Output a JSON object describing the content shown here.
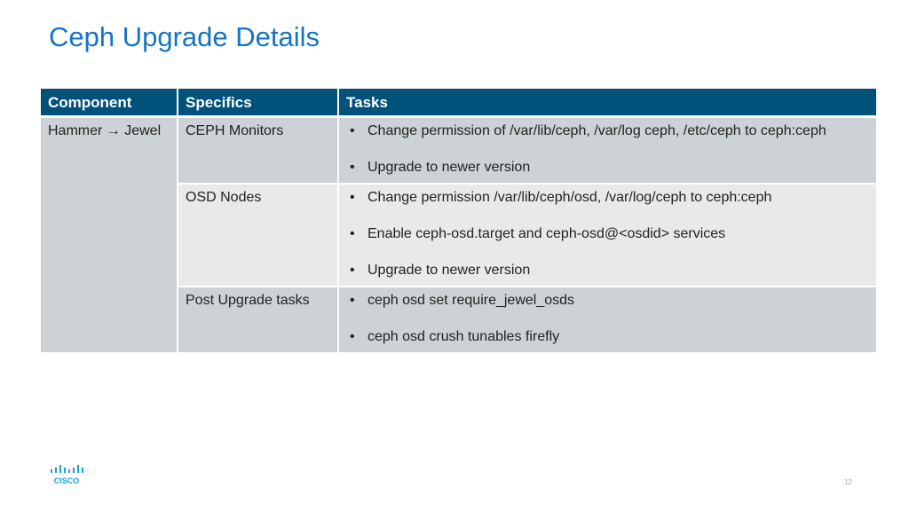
{
  "title": "Ceph Upgrade Details",
  "table": {
    "headers": [
      "Component",
      "Specifics",
      "Tasks"
    ],
    "component": "Hammer → Jewel",
    "rows": [
      {
        "specifics": "CEPH Monitors",
        "tasks": [
          "Change permission of /var/lib/ceph, /var/log ceph, /etc/ceph to ceph:ceph",
          "Upgrade to newer version"
        ]
      },
      {
        "specifics": "OSD Nodes",
        "tasks": [
          "Change permission /var/lib/ceph/osd, /var/log/ceph to ceph:ceph",
          "Enable ceph-osd.target and ceph-osd@<osdid> services",
          "Upgrade to newer version"
        ]
      },
      {
        "specifics": "Post Upgrade tasks",
        "tasks": [
          "ceph osd set require_jewel_osds",
          "ceph osd crush tunables firefly"
        ]
      }
    ]
  },
  "footer": {
    "logo_text": "CISCO",
    "page_number": "12"
  },
  "colors": {
    "title": "#1574c4",
    "header_bg": "#00527a",
    "row_dark": "#ccd2d6",
    "row_light": "#e7e9eb"
  }
}
